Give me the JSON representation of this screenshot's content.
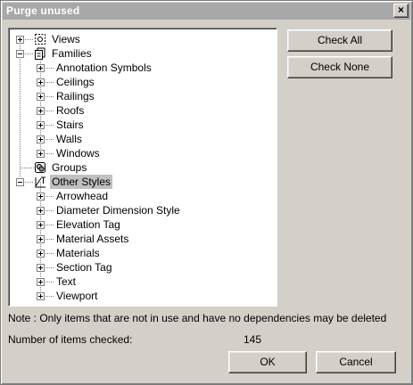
{
  "window": {
    "title": "Purge unused",
    "close_glyph": "×"
  },
  "tree": {
    "views": "Views",
    "families": "Families",
    "family_items": [
      "Annotation Symbols",
      "Ceilings",
      "Railings",
      "Roofs",
      "Stairs",
      "Walls",
      "Windows"
    ],
    "groups": "Groups",
    "other_styles": "Other Styles",
    "style_items": [
      "Arrowhead",
      "Diameter Dimension Style",
      "Elevation Tag",
      "Material Assets",
      "Materials",
      "Section Tag",
      "Text",
      "Viewport"
    ]
  },
  "buttons": {
    "check_all": "Check All",
    "check_none": "Check None",
    "ok": "OK",
    "cancel": "Cancel"
  },
  "note": "Note : Only items that are not in use and have no dependencies may be deleted",
  "count": {
    "label": "Number of items checked:",
    "value": "145"
  },
  "colors": {
    "selection": "#c0c0c0",
    "dialog_bg": "#d4d0c8",
    "titlebar": "#a8a8a8"
  },
  "icons": {
    "views": "views-icon",
    "families": "families-icon",
    "groups": "groups-icon",
    "other_styles": "styles-icon"
  }
}
